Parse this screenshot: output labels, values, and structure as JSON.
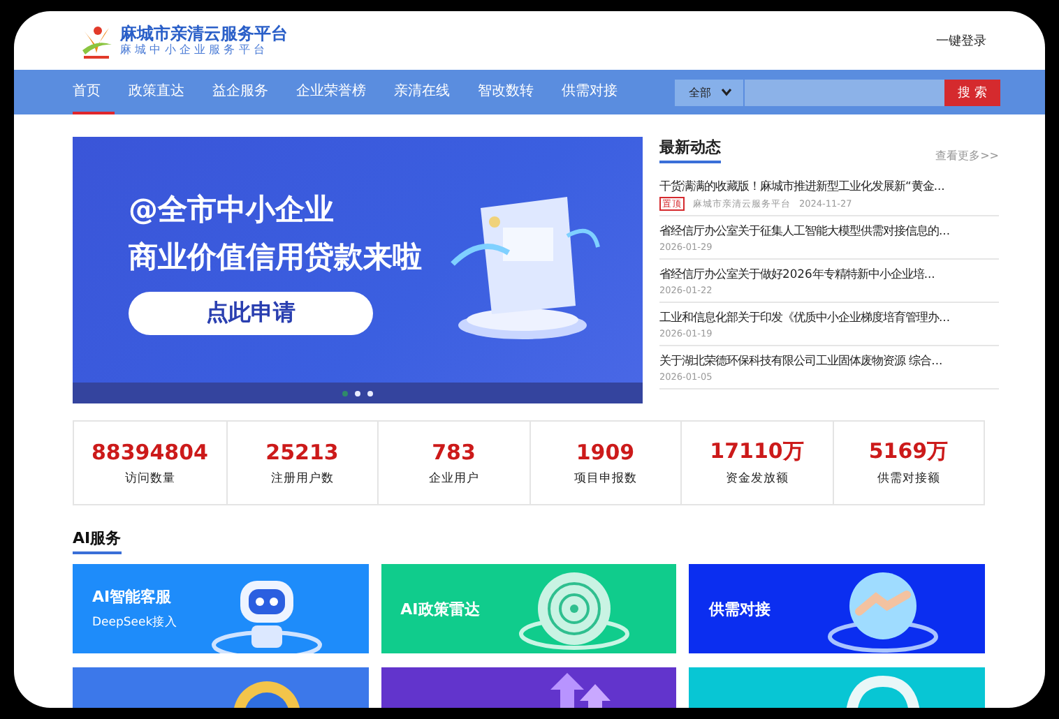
{
  "header": {
    "title": "麻城市亲清云服务平台",
    "subtitle": "麻城中小企业服务平台",
    "login": "一键登录"
  },
  "nav": {
    "items": [
      {
        "label": "首页",
        "selected": true
      },
      {
        "label": "政策直达",
        "selected": false
      },
      {
        "label": "益企服务",
        "selected": false
      },
      {
        "label": "企业荣誉榜",
        "selected": false
      },
      {
        "label": "亲清在线",
        "selected": false
      },
      {
        "label": "智改数转",
        "selected": false
      },
      {
        "label": "供需对接",
        "selected": false
      }
    ],
    "search": {
      "scope": "全部",
      "button": "搜 索"
    }
  },
  "banner": {
    "line1": "@全市中小企业",
    "line2": "商业价值信用贷款来啦",
    "button": "点此申请",
    "dots": [
      {
        "selected": true
      },
      {
        "selected": false
      },
      {
        "selected": false
      }
    ]
  },
  "news": {
    "title": "最新动态",
    "more": "查看更多>>",
    "items": [
      {
        "title": "干货满满的收藏版！麻城市推进新型工业化发展新“黄金...",
        "badge": "置顶",
        "source": "麻城市亲清云服务平台",
        "date": "2024-11-27"
      },
      {
        "title": "省经信厅办公室关于征集人工智能大模型供需对接信息的...",
        "date": "2026-01-29"
      },
      {
        "title": "省经信厅办公室关于做好2026年专精特新中小企业培...",
        "date": "2026-01-22"
      },
      {
        "title": "工业和信息化部关于印发《优质中小企业梯度培育管理办...",
        "date": "2026-01-19"
      },
      {
        "title": "关于湖北荣德环保科技有限公司工业固体废物资源 综合...",
        "date": "2026-01-05"
      }
    ]
  },
  "stats": [
    {
      "value": "88394804",
      "label": "访问数量"
    },
    {
      "value": "25213",
      "label": "注册用户数"
    },
    {
      "value": "783",
      "label": "企业用户"
    },
    {
      "value": "1909",
      "label": "项目申报数"
    },
    {
      "value": "17110万",
      "label": "资金发放额"
    },
    {
      "value": "5169万",
      "label": "供需对接额"
    }
  ],
  "ai_services": {
    "title": "AI服务",
    "cards": [
      {
        "title": "AI智能客服",
        "subtitle": "DeepSeek接入",
        "color": "#1e8cfa",
        "kind": "robot"
      },
      {
        "title": "AI政策雷达",
        "color": "#10cc8c",
        "kind": "radar"
      },
      {
        "title": "供需对接",
        "color": "#0b2ef0",
        "kind": "handshake"
      },
      {
        "color": "#3c78ea",
        "kind": "coin"
      },
      {
        "color": "#6234cc",
        "kind": "arrows"
      },
      {
        "color": "#08c6d4",
        "kind": "headset"
      }
    ]
  }
}
